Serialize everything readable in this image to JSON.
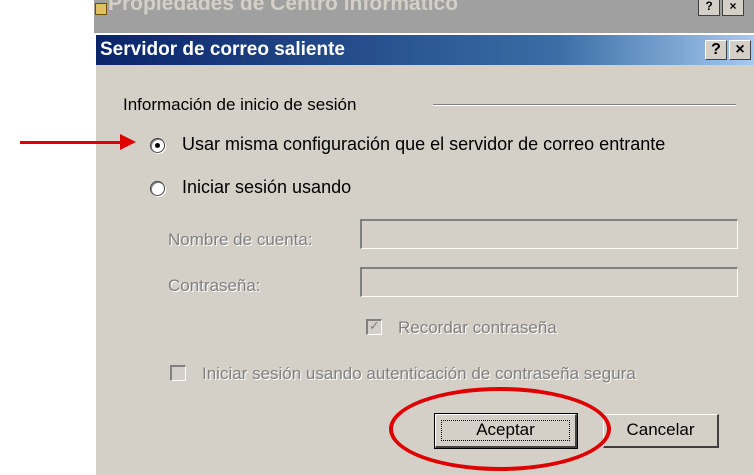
{
  "parent_window": {
    "title": "Propiedades de Centro informático",
    "buttons": [
      "?",
      "×"
    ]
  },
  "dialog": {
    "title": "Servidor de correo saliente",
    "help_button": "?",
    "close_button": "×",
    "group_label": "Información de inicio de sesión",
    "radio_same_config": {
      "label": "Usar misma configuración que el servidor de correo entrante",
      "checked": true
    },
    "radio_login_using": {
      "label": "Iniciar sesión usando",
      "checked": false
    },
    "account_name": {
      "label": "Nombre de cuenta:",
      "value": ""
    },
    "password": {
      "label": "Contraseña:",
      "value": ""
    },
    "remember_password": {
      "label": "Recordar contraseña",
      "checked": true,
      "enabled": false
    },
    "secure_auth": {
      "label": "Iniciar sesión usando autenticación de contraseña segura",
      "checked": false,
      "enabled": false
    },
    "ok_button": "Aceptar",
    "cancel_button": "Cancelar"
  },
  "annotations": {
    "color": "#e00000"
  },
  "colors": {
    "dialog_face": "#d4d0c8",
    "titlebar_start": "#0a246a",
    "titlebar_end": "#a6caf0",
    "disabled_text": "#808080"
  }
}
